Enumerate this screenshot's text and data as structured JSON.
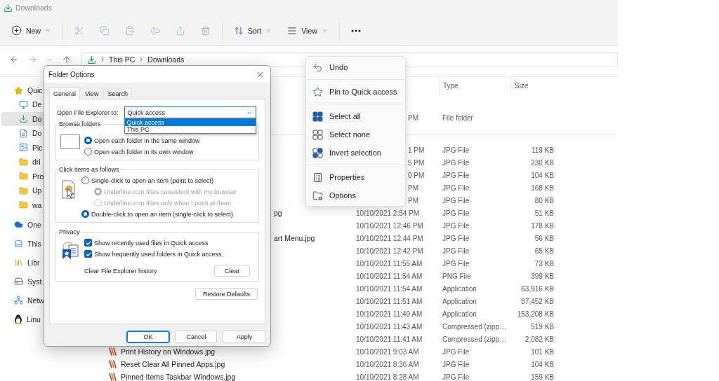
{
  "window": {
    "title": "Downloads"
  },
  "toolbar": {
    "groups": [
      [
        {
          "kind": "new",
          "label": "New",
          "disabled": false
        }
      ],
      [
        {
          "kind": "cut",
          "disabled": true
        },
        {
          "kind": "copy",
          "disabled": true
        },
        {
          "kind": "paste",
          "disabled": true
        },
        {
          "kind": "rename",
          "disabled": true
        },
        {
          "kind": "share",
          "disabled": true
        },
        {
          "kind": "delete",
          "disabled": true
        }
      ],
      [
        {
          "kind": "sort",
          "label": "Sort",
          "disabled": false
        },
        {
          "kind": "view",
          "label": "View",
          "disabled": false
        }
      ],
      [
        {
          "kind": "more",
          "disabled": false
        }
      ]
    ]
  },
  "address": {
    "segments": [
      "This PC",
      "Downloads"
    ]
  },
  "sidebar": {
    "items": [
      {
        "label": "Quic",
        "kind": "star",
        "selected": false,
        "children": [
          {
            "label": "De",
            "kind": "desktop",
            "selected": false
          },
          {
            "label": "Do",
            "kind": "download",
            "selected": true
          },
          {
            "label": "Do",
            "kind": "document",
            "selected": false
          },
          {
            "label": "Pic",
            "kind": "pictures",
            "selected": false
          },
          {
            "label": "dri",
            "kind": "folder",
            "selected": false
          },
          {
            "label": "Pro",
            "kind": "folder",
            "selected": false
          },
          {
            "label": "Up",
            "kind": "folder",
            "selected": false
          },
          {
            "label": "wa",
            "kind": "folder",
            "selected": false
          }
        ]
      },
      {
        "label": "One",
        "kind": "cloud",
        "selected": false
      },
      {
        "label": "This",
        "kind": "pc",
        "selected": false
      },
      {
        "label": "Libr",
        "kind": "library",
        "selected": false
      },
      {
        "label": "Syst",
        "kind": "drive",
        "selected": false
      },
      {
        "label": "Netw",
        "kind": "network",
        "selected": false
      },
      {
        "label": "Linu",
        "kind": "linux",
        "selected": false
      }
    ]
  },
  "file_list": {
    "columns": [
      {
        "label": "Type"
      },
      {
        "label": "Size"
      }
    ],
    "groups": [
      {
        "rows": [
          {
            "kind": "cut",
            "date": "PM",
            "type": "File folder"
          }
        ]
      },
      {
        "rows": [
          {
            "kind": "cut",
            "date": "1 PM",
            "type": "JPG File",
            "size": "119 KB"
          },
          {
            "kind": "cut",
            "date": "5 PM",
            "type": "JPG File",
            "size": "230 KB"
          },
          {
            "kind": "cut",
            "date": "0 PM",
            "type": "JPG File",
            "size": "104 KB"
          },
          {
            "kind": "cut",
            "date": "PM",
            "type": "JPG File",
            "size": "168 KB"
          },
          {
            "kind": "cut",
            "date": "PM",
            "type": "JPG File",
            "size": "80 KB"
          },
          {
            "kind": "tail",
            "name": "pg",
            "date": "10/10/2021 2:54 PM",
            "type": "JPG File",
            "size": "51 KB"
          },
          {
            "kind": "plain",
            "date": "10/10/2021 12:46 PM",
            "type": "JPG File",
            "size": "178 KB"
          },
          {
            "kind": "tail",
            "name": "art Menu.jpg",
            "date": "10/10/2021 12:44 PM",
            "type": "JPG File",
            "size": "56 KB"
          },
          {
            "kind": "plain",
            "date": "10/10/2021 12:42 PM",
            "type": "JPG File",
            "size": "65 KB"
          },
          {
            "kind": "plain",
            "date": "10/10/2021 11:55 AM",
            "type": "JPG File",
            "size": "73 KB"
          },
          {
            "kind": "plain",
            "date": "10/10/2021 11:54 AM",
            "type": "PNG File",
            "size": "399 KB"
          },
          {
            "kind": "plain",
            "date": "10/10/2021 11:54 AM",
            "type": "Application",
            "size": "63,916 KB"
          },
          {
            "kind": "plain",
            "date": "10/10/2021 11:51 AM",
            "type": "Application",
            "size": "87,452 KB"
          },
          {
            "kind": "plain",
            "date": "10/10/2021 11:49 AM",
            "type": "Application",
            "size": "153,208 KB"
          },
          {
            "kind": "plain",
            "date": "10/10/2021 11:43 AM",
            "type": "Compressed (zipp…",
            "size": "519 KB"
          },
          {
            "kind": "plain",
            "date": "10/10/2021 11:41 AM",
            "type": "Compressed (zipp…",
            "size": "2,082 KB"
          },
          {
            "kind": "file",
            "name": "Print History on Windows.jpg",
            "date": "10/10/2021 9:03 AM",
            "type": "JPG File",
            "size": "101 KB"
          },
          {
            "kind": "file",
            "name": "Reset Clear All Pinned Apps.jpg",
            "date": "10/10/2021 8:36 AM",
            "type": "JPG File",
            "size": "104 KB"
          },
          {
            "kind": "file",
            "name": "Pinned Items Taskbar Windows.jpg",
            "date": "10/10/2021 8:28 AM",
            "type": "JPG File",
            "size": "159 KB"
          }
        ]
      }
    ]
  },
  "folder_options": {
    "title": "Folder Options",
    "tabs": [
      {
        "label": "General",
        "selected": true
      },
      {
        "label": "View",
        "selected": false
      },
      {
        "label": "Search",
        "selected": false
      }
    ],
    "open_to": {
      "label": "Open File Explorer to:",
      "value": "Quick access",
      "expanded": true,
      "options": [
        {
          "label": "Quick access",
          "selected": true
        },
        {
          "label": "This PC",
          "selected": false
        }
      ]
    },
    "browse_folders": {
      "title": "Browse folders",
      "options": [
        {
          "label": "Open each folder in the same window",
          "selected": true,
          "disabled": false
        },
        {
          "label": "Open each folder in its own window",
          "selected": false,
          "disabled": false
        }
      ]
    },
    "click_items": {
      "title": "Click items as follows",
      "options": [
        {
          "label": "Single-click to open an item (point to select)",
          "selected": false,
          "disabled": false,
          "children": [
            {
              "label": "Underline icon titles consistent with my browser",
              "selected": true,
              "disabled": true
            },
            {
              "label": "Underline icon titles only when I point at them",
              "selected": false,
              "disabled": true
            }
          ]
        },
        {
          "label": "Double-click to open an item (single-click to select)",
          "selected": true,
          "disabled": false
        }
      ]
    },
    "privacy": {
      "title": "Privacy",
      "checkboxes": [
        {
          "label": "Show recently used files in Quick access",
          "checked": true
        },
        {
          "label": "Show frequently used folders in Quick access",
          "checked": true
        }
      ],
      "clear_label": "Clear File Explorer history",
      "clear_button": "Clear"
    },
    "restore_button": "Restore Defaults",
    "buttons": [
      {
        "label": "OK",
        "default": true
      },
      {
        "label": "Cancel",
        "default": false
      },
      {
        "label": "Apply",
        "default": false
      }
    ]
  },
  "context_menu": {
    "groups": [
      [
        {
          "kind": "undo",
          "label": "Undo"
        }
      ],
      [
        {
          "kind": "pin",
          "label": "Pin to Quick access"
        }
      ],
      [
        {
          "kind": "select_all",
          "label": "Select all"
        },
        {
          "kind": "select_none",
          "label": "Select none"
        },
        {
          "kind": "invert",
          "label": "Invert selection"
        }
      ],
      [
        {
          "kind": "properties",
          "label": "Properties"
        },
        {
          "kind": "options",
          "label": "Options"
        }
      ]
    ]
  }
}
